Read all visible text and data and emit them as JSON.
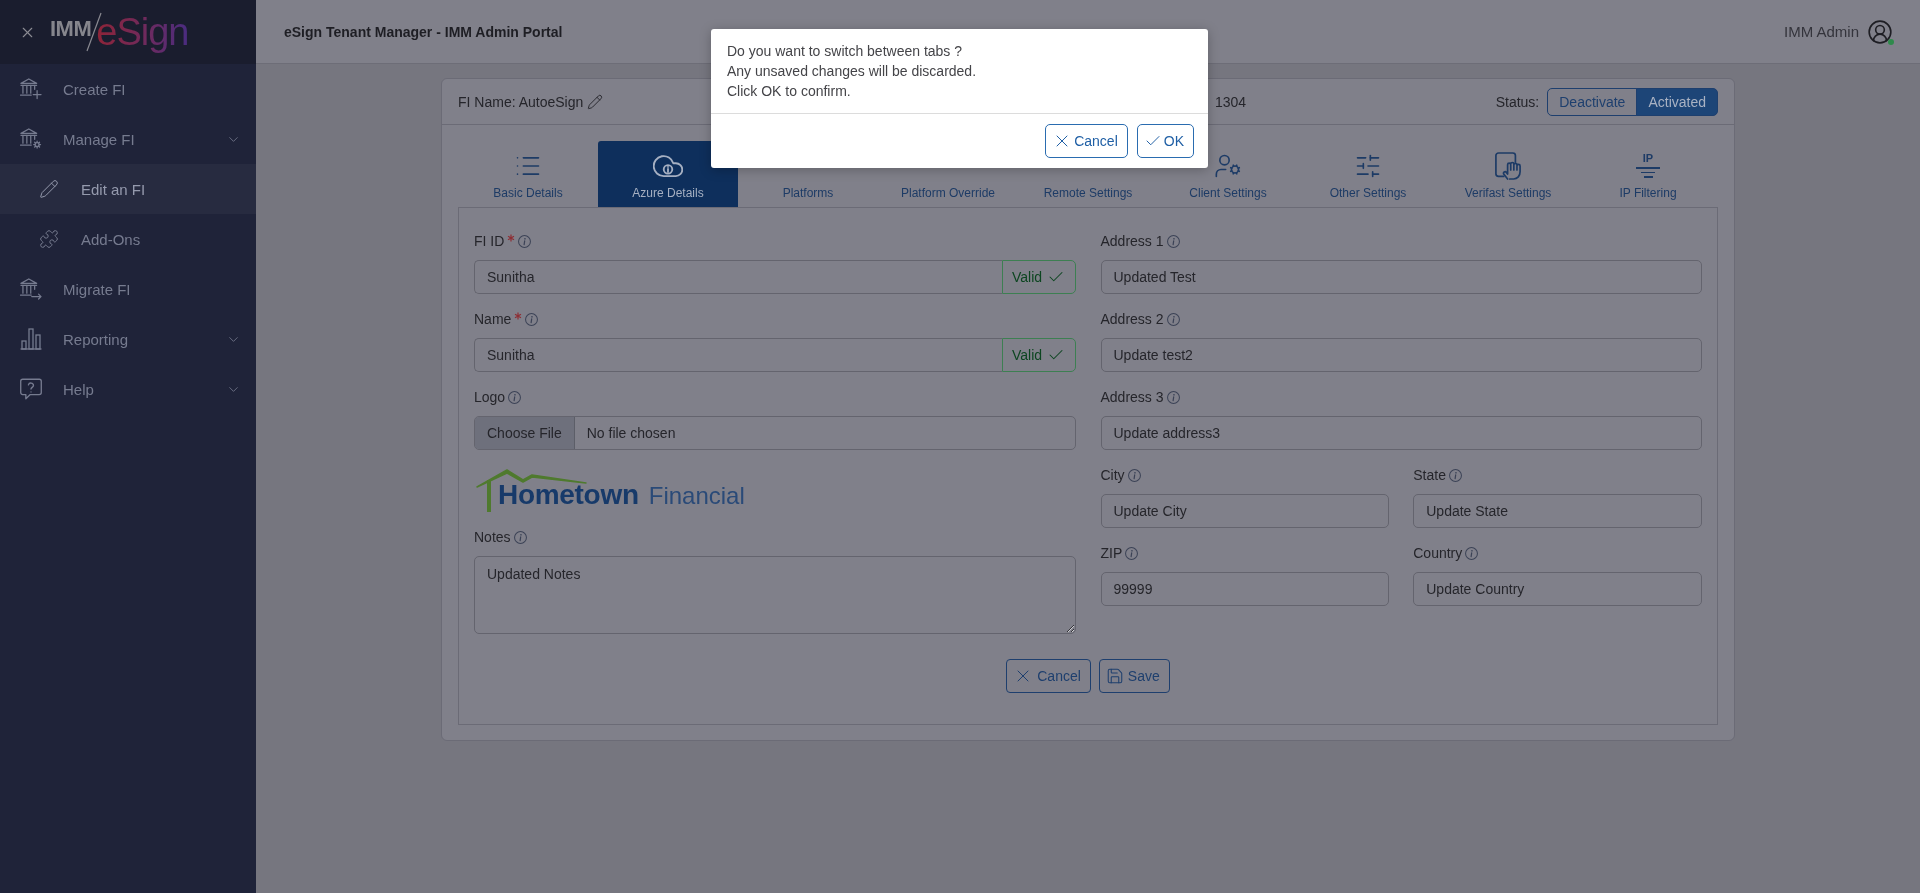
{
  "sidebar": {
    "logo": {
      "part_1": "IMM",
      "part_2": "eSign"
    },
    "items": [
      {
        "label": "Create FI",
        "kind": "link",
        "selected": false
      },
      {
        "label": "Manage FI",
        "kind": "group",
        "selected": false,
        "children": [
          {
            "label": "Edit an FI",
            "selected": true
          },
          {
            "label": "Add-Ons",
            "selected": false
          }
        ]
      },
      {
        "label": "Migrate FI",
        "kind": "link",
        "selected": false
      },
      {
        "label": "Reporting",
        "kind": "group",
        "selected": false
      },
      {
        "label": "Help",
        "kind": "group",
        "selected": false
      }
    ]
  },
  "header": {
    "title": "eSign Tenant Manager - IMM Admin Portal",
    "user": {
      "name": "IMM Admin",
      "online": true
    }
  },
  "card": {
    "fi_name": "FI Name: AutoeSign",
    "fi_number": "1304",
    "status_label": "Status:",
    "status_options": [
      {
        "label": "Deactivate",
        "selected": false
      },
      {
        "label": "Activated",
        "selected": true
      }
    ]
  },
  "tabs": [
    {
      "label": "Basic Details",
      "selected": false
    },
    {
      "label": "Azure Details",
      "selected": true
    },
    {
      "label": "Platforms",
      "selected": false
    },
    {
      "label": "Platform Override",
      "selected": false
    },
    {
      "label": "Remote Settings",
      "selected": false
    },
    {
      "label": "Client Settings",
      "selected": false
    },
    {
      "label": "Other Settings",
      "selected": false
    },
    {
      "label": "Verifast Settings",
      "selected": false
    },
    {
      "label": "IP Filtering",
      "selected": false,
      "icon_text": "IP"
    }
  ],
  "form": {
    "left": [
      {
        "kind": "text",
        "label": "FI ID",
        "required": true,
        "value": "Sunitha",
        "validation": "Valid"
      },
      {
        "kind": "text",
        "label": "Name",
        "required": true,
        "value": "Sunitha",
        "validation": "Valid"
      },
      {
        "kind": "file",
        "label": "Logo",
        "required": false,
        "button": "Choose File",
        "value": "No file chosen"
      },
      {
        "kind": "logo",
        "word_1": "Hometown",
        "word_2": "Financial"
      },
      {
        "kind": "textarea",
        "label": "Notes",
        "required": false,
        "value": "Updated Notes"
      }
    ],
    "right": [
      {
        "fields": [
          {
            "label": "Address 1",
            "required": false,
            "value": "Updated Test"
          }
        ]
      },
      {
        "fields": [
          {
            "label": "Address 2",
            "required": false,
            "value": "Update test2"
          }
        ]
      },
      {
        "fields": [
          {
            "label": "Address 3",
            "required": false,
            "value": "Update address3"
          }
        ]
      },
      {
        "fields": [
          {
            "label": "City",
            "required": false,
            "value": "Update City"
          },
          {
            "label": "State",
            "required": false,
            "value": "Update State"
          }
        ]
      },
      {
        "fields": [
          {
            "label": "ZIP",
            "required": false,
            "value": "99999"
          },
          {
            "label": "Country",
            "required": false,
            "value": "Update Country"
          }
        ]
      }
    ],
    "actions": [
      {
        "label": "Cancel",
        "kind": "cancel"
      },
      {
        "label": "Save",
        "kind": "save"
      }
    ]
  },
  "dialog": {
    "message": [
      "Do you want to switch between tabs ?",
      "Any unsaved changes will be discarded.",
      "Click OK to confirm."
    ],
    "buttons": [
      {
        "label": "Cancel",
        "kind": "cancel"
      },
      {
        "label": "OK",
        "kind": "confirm"
      }
    ]
  }
}
